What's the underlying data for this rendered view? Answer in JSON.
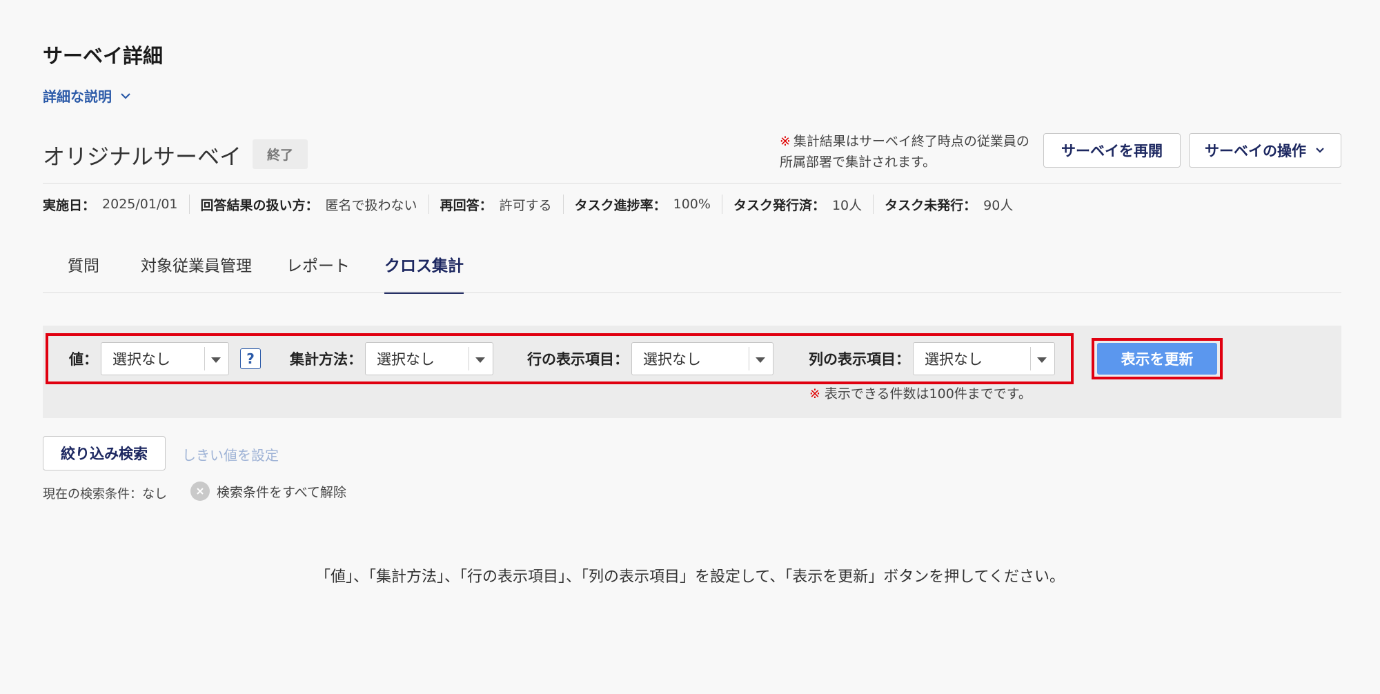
{
  "header": {
    "title": "サーベイ詳細",
    "description_toggle": "詳細な説明"
  },
  "survey": {
    "name": "オリジナルサーベイ",
    "status": "終了"
  },
  "notice": {
    "mark": "※",
    "text": "集計結果はサーベイ終了時点の従業員の所属部署で集計されます。"
  },
  "actions": {
    "reopen": "サーベイを再開",
    "operations": "サーベイの操作"
  },
  "meta": [
    {
      "label": "実施日：",
      "value": "2025/01/01"
    },
    {
      "label": "回答結果の扱い方：",
      "value": "匿名で扱わない"
    },
    {
      "label": "再回答：",
      "value": "許可する"
    },
    {
      "label": "タスク進捗率：",
      "value": "100%"
    },
    {
      "label": "タスク発行済：",
      "value": "10人"
    },
    {
      "label": "タスク未発行：",
      "value": "90人"
    }
  ],
  "tabs": [
    {
      "label": "質問"
    },
    {
      "label": "対象従業員管理"
    },
    {
      "label": "レポート"
    },
    {
      "label": "クロス集計"
    }
  ],
  "filters": {
    "value": {
      "label": "値：",
      "selected": "選択なし"
    },
    "help": "?",
    "method": {
      "label": "集計方法：",
      "selected": "選択なし"
    },
    "row_item": {
      "label": "行の表示項目：",
      "selected": "選択なし"
    },
    "col_item": {
      "label": "列の表示項目：",
      "selected": "選択なし"
    },
    "update_button": "表示を更新",
    "limit_mark": "※",
    "limit_note": "表示できる件数は100件までです。"
  },
  "search": {
    "filter_button": "絞り込み検索",
    "threshold_link": "しきい値を設定",
    "current_condition": "現在の検索条件：なし",
    "clear_all": "検索条件をすべて解除"
  },
  "instruction": "「値」、「集計方法」、「行の表示項目」、「列の表示項目」を設定して、「表示を更新」ボタンを押してください。"
}
